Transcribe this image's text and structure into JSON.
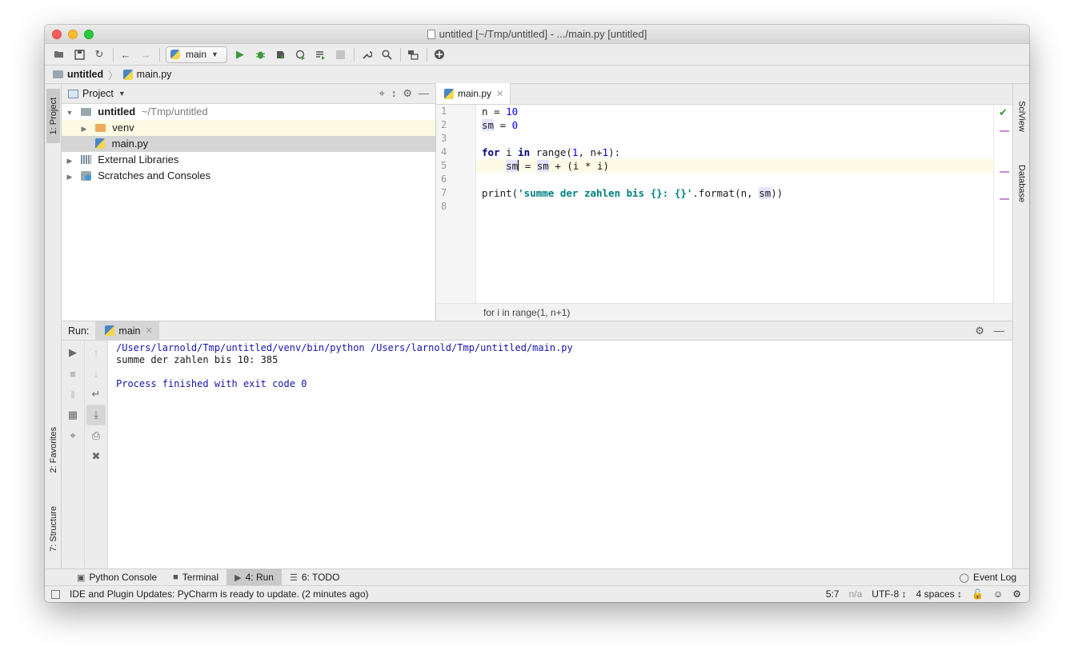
{
  "window": {
    "title": "untitled [~/Tmp/untitled] - .../main.py [untitled]"
  },
  "toolbar": {
    "run_config": "main",
    "icons": [
      "open-folder-icon",
      "save-icon",
      "sync-icon",
      "back-icon",
      "forward-icon",
      "python-icon",
      "run-icon",
      "debug-icon",
      "coverage-icon",
      "profile-icon",
      "concurrency-icon",
      "stop-icon",
      "wrench-icon",
      "search-icon",
      "vcs-icon",
      "plugin-icon"
    ]
  },
  "navbar": {
    "project": "untitled",
    "file": "main.py"
  },
  "left_strip": {
    "project": "1: Project",
    "favorites": "2: Favorites",
    "structure": "7: Structure"
  },
  "right_strip": {
    "sciview": "SciView",
    "database": "Database"
  },
  "project_panel": {
    "title": "Project",
    "tree": {
      "root_name": "untitled",
      "root_path": "~/Tmp/untitled",
      "venv": "venv",
      "main_file": "main.py",
      "external": "External Libraries",
      "scratches": "Scratches and Consoles"
    }
  },
  "editor": {
    "tab": "main.py",
    "line_numbers": [
      "1",
      "2",
      "3",
      "4",
      "5",
      "6",
      "7",
      "8"
    ],
    "code": {
      "l1_var": "n",
      "l1_op": " = ",
      "l1_num": "10",
      "l2_var": "sm",
      "l2_op": " = ",
      "l2_num": "0",
      "l4_kw1": "for",
      "l4_a": " i ",
      "l4_kw2": "in",
      "l4_b": " range(",
      "l4_num": "1",
      "l4_c": ", n+",
      "l4_num2": "1",
      "l4_d": "):",
      "l5_indent": "    ",
      "l5_var1a": "sm",
      "l5_mid": " = ",
      "l5_var2": "sm",
      "l5_rest": " + (i * i)",
      "l7_a": "print(",
      "l7_str": "'summe der zahlen bis {}: {}'",
      "l7_b": ".format(n, ",
      "l7_var": "sm",
      "l7_c": "))"
    },
    "breadcrumb": "for i in range(1, n+1)"
  },
  "run_panel": {
    "label": "Run:",
    "tab": "main",
    "console": {
      "line1": "/Users/larnold/Tmp/untitled/venv/bin/python /Users/larnold/Tmp/untitled/main.py",
      "line2": "summe der zahlen bis 10: 385",
      "line4": "Process finished with exit code 0"
    }
  },
  "bottom_tabs": {
    "python_console": "Python Console",
    "terminal": "Terminal",
    "run": "4: Run",
    "todo": "6: TODO",
    "event_log": "Event Log"
  },
  "statusbar": {
    "message": "IDE and Plugin Updates: PyCharm is ready to update. (2 minutes ago)",
    "position": "5:7",
    "na": "n/a",
    "encoding": "UTF-8 ↕",
    "indent": "4 spaces ↕"
  },
  "colors": {
    "keyword": "#000080",
    "number": "#0000ff",
    "string": "#008080",
    "console_blue": "#1515a8",
    "current_line": "#fdfae6"
  }
}
